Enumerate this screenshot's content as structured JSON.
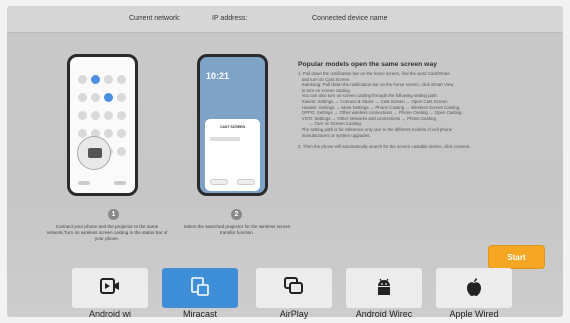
{
  "topbar": {
    "network": "Current network:",
    "ip": "IP address:",
    "device": "Connected device name"
  },
  "phone2": {
    "clock": "10:21",
    "dialog_title": "CAST SCREEN"
  },
  "steps": [
    {
      "num": "1",
      "caption": "Connect your phone and the projector to the same network.Turn on wireless screen casting in the status bar of your phone."
    },
    {
      "num": "2",
      "caption": "Select the searched projector for the wireless screen transfer function."
    }
  ],
  "instructions": {
    "title": "Popular models open the same screen way",
    "lines": [
      "1. Pull down the notification bar on the home screen, find the word Cast/Share",
      "   and turn on Cast Screen.",
      "   Samsung: Pull down the notification bar on the home screen, click Smart View",
      "   to turn on screen casting.",
      "   You can also turn on screen casting through the following setting path:",
      "   Xiaomi: Settings → Connect & Share → Cast Screen → Open Cast Screen.",
      "   Huawei: Settings → More Settings → Phone Casting → Wireless Screen Casting.",
      "   OPPO: Settings → Other wireless connections → Phone Casting → Open Casting.",
      "   VIVO: Settings → Other networks and connections → Phone Casting",
      "         → Turn on Screen Casting.",
      "   The setting path is for reference only due to the different models of cell phone",
      "   manufacturers or system upgrades.",
      "",
      "2. Then the phone will automatically search for the screen castable device, click connect."
    ]
  },
  "start_label": "Start",
  "tabs": [
    {
      "label": "Android wi",
      "icon": "android-cast-icon"
    },
    {
      "label": "Miracast",
      "icon": "miracast-icon"
    },
    {
      "label": "AirPlay",
      "icon": "airplay-icon"
    },
    {
      "label": "Android Wirec",
      "icon": "android-icon"
    },
    {
      "label": "Apple Wired",
      "icon": "apple-icon"
    }
  ],
  "colors": {
    "accent": "#3f8fd8",
    "start": "#f5a623"
  }
}
